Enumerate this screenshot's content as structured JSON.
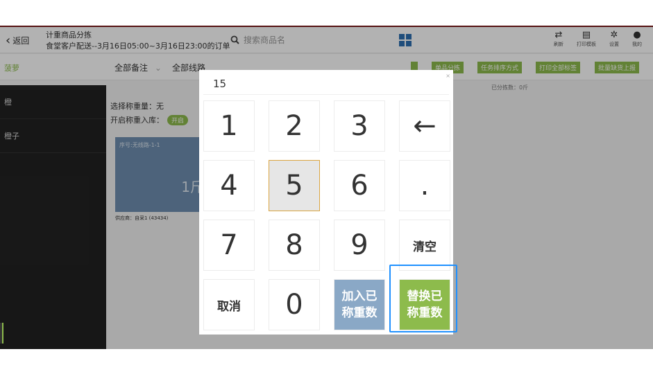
{
  "header": {
    "back_label": "返回",
    "title": "计重商品分拣",
    "subtitle": "食堂客户配送--3月16日05:00~3月16日23:00的订单",
    "search_placeholder": "搜索商品名",
    "icons": [
      {
        "name": "refresh-icon",
        "label": "刷新"
      },
      {
        "name": "print-template-icon",
        "label": "打印模板"
      },
      {
        "name": "settings-icon",
        "label": "设置"
      },
      {
        "name": "user-icon",
        "label": "我的"
      }
    ]
  },
  "toolbar": {
    "selected_item": "菠萝",
    "filter_remark": "全部备注",
    "filter_route": "全部线路",
    "buttons": [
      "单品分拣",
      "任务排序方式",
      "打印全部标签",
      "批量缺货上报"
    ]
  },
  "sidebar": {
    "items": [
      {
        "label": "橙"
      },
      {
        "label": "橙子"
      }
    ]
  },
  "content": {
    "weigh_label": "选择称重量：无",
    "store_label": "开启称重入库：",
    "toggle": "开启",
    "sorted_count": "已分拣数：0斤",
    "card": {
      "seq": "序号:无线路-1-1",
      "weight": "1斤",
      "supplier": "供应商：自采1 (43434)"
    }
  },
  "keypad": {
    "value": "15",
    "close": "×",
    "keys": [
      "1",
      "2",
      "3",
      "←",
      "4",
      "5",
      "6",
      ".",
      "7",
      "8",
      "9",
      "清空",
      "取消",
      "0",
      "加入已称重数",
      "替换已称重数"
    ],
    "add_label_line1": "加入已",
    "add_label_line2": "称重数",
    "replace_label_line1": "替换已",
    "replace_label_line2": "称重数"
  },
  "colors": {
    "accent_green": "#8dbb4c",
    "accent_blue": "#8aa8c6",
    "focus": "#1e90ff"
  }
}
